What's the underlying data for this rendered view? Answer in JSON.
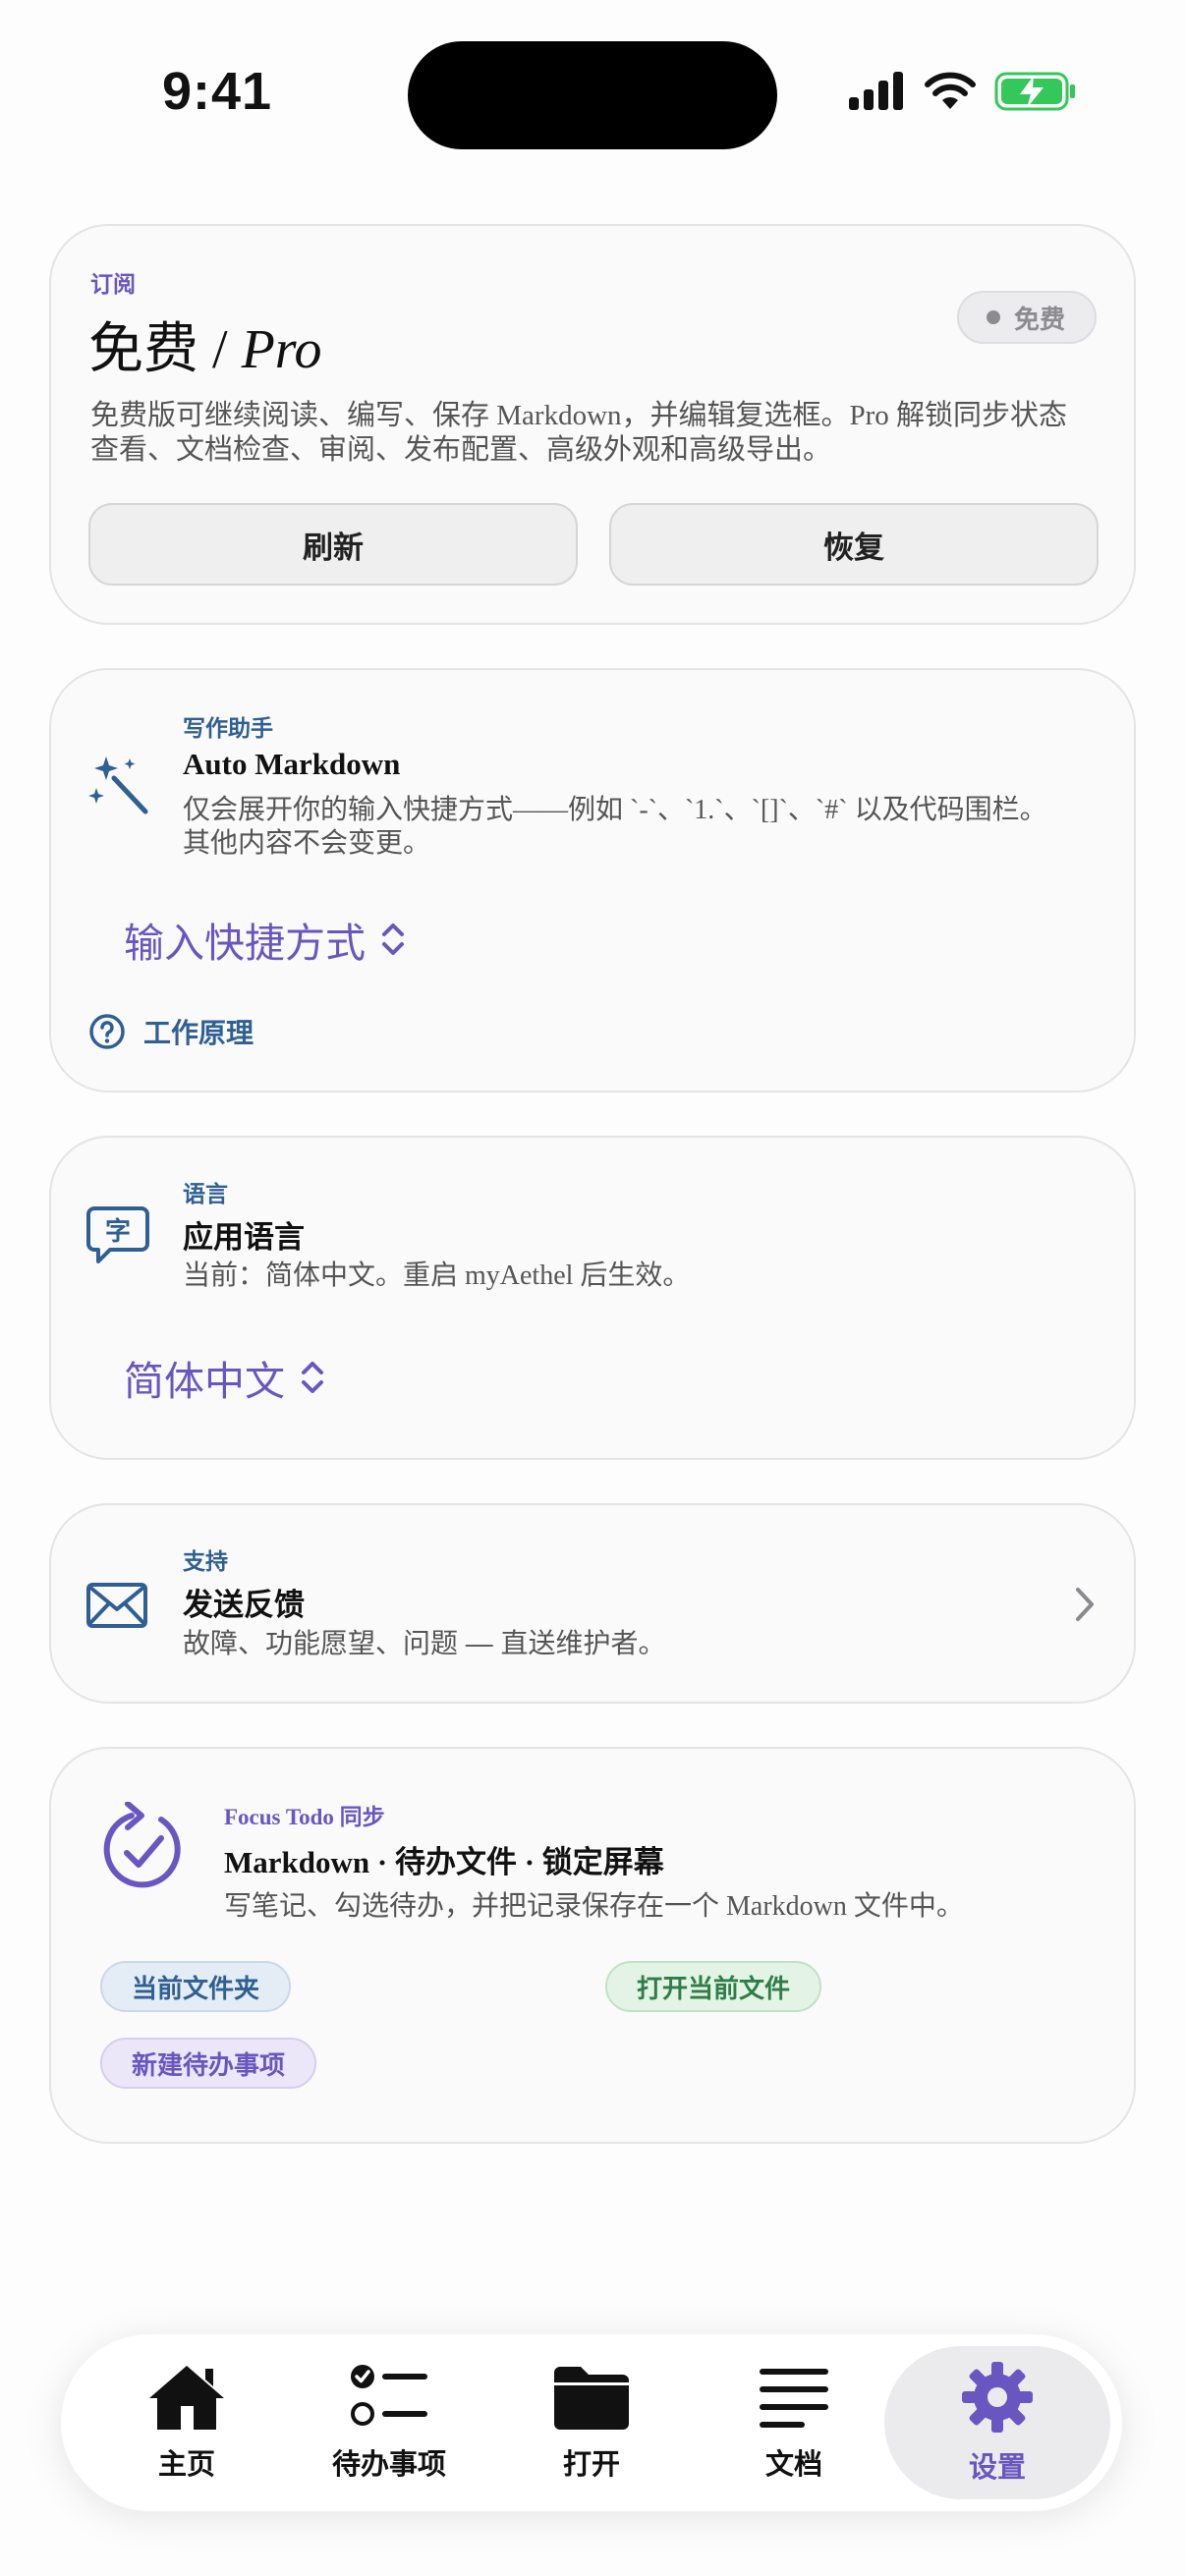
{
  "status_bar": {
    "time": "9:41"
  },
  "subscription": {
    "eyebrow": "订阅",
    "title_main": "免费 / ",
    "title_pro": "Pro",
    "badge": "免费",
    "description": "免费版可继续阅读、编写、保存 Markdown，并编辑复选框。Pro 解锁同步状态查看、文档检查、审阅、发布配置、高级外观和高级导出。",
    "refresh_label": "刷新",
    "restore_label": "恢复"
  },
  "writing": {
    "eyebrow": "写作助手",
    "title": "Auto Markdown",
    "description": "仅会展开你的输入快捷方式——例如 `-`、`1.`、`[]`、`#` 以及代码围栏。其他内容不会变更。",
    "picker": "输入快捷方式",
    "how_it_works": "工作原理"
  },
  "language": {
    "eyebrow": "语言",
    "title": "应用语言",
    "description": "当前：简体中文。重启 myAethel 后生效。",
    "picker": "简体中文"
  },
  "support": {
    "eyebrow": "支持",
    "title": "发送反馈",
    "description": "故障、功能愿望、问题 — 直送维护者。"
  },
  "focus": {
    "eyebrow": "Focus Todo 同步",
    "title": "Markdown · 待办文件 · 锁定屏幕",
    "description": "写笔记、勾选待办，并把记录保存在一个 Markdown 文件中。",
    "pill_folder": "当前文件夹",
    "pill_open": "打开当前文件",
    "pill_new": "新建待办事项"
  },
  "tabs": [
    {
      "label": "主页",
      "icon": "house-icon"
    },
    {
      "label": "待办事项",
      "icon": "checklist-icon"
    },
    {
      "label": "打开",
      "icon": "folder-icon"
    },
    {
      "label": "文档",
      "icon": "lines-icon"
    },
    {
      "label": "设置",
      "icon": "gear-icon",
      "active": true
    }
  ],
  "colors": {
    "accent": "#6a56c0",
    "blue": "#2f5f93",
    "green": "#2f7d47",
    "battery": "#34c759"
  }
}
